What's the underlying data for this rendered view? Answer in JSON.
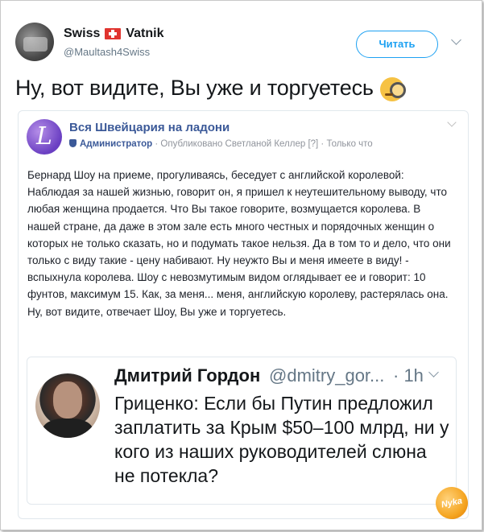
{
  "tweet": {
    "display_name_left": "Swiss",
    "display_name_right": "Vatnik",
    "handle": "@Maultash4Swiss",
    "read_button": "Читать",
    "text": "Ну, вот видите, Вы уже и торгуетесь"
  },
  "fb_post": {
    "page_title": "Вся Швейцария на ладони",
    "role": "Администратор",
    "meta": "· Опубликовано Светланой Келлер [?] · Только что",
    "body": "Бернард Шоу на приеме, прогуливаясь, беседует с английской королевой: Наблюдая за нашей жизнью, говорит он, я пришел к неутешительному выводу, что любая женщина продается. Что Вы такое говорите, возмущается королева. В нашей стране, да даже в этом зале есть много честных и порядочных женщин о которых не только сказать, но и подумать такое нельзя. Да в том то и дело, что они только с виду такие - цену набивают. Ну неужто Вы и меня имеете в виду! - вспыхнула королева. Шоу с невозмутимым видом оглядывает ее и говорит: 10 фунтов, максимум 15. Как, за меня... меня, английскую королеву, растерялась она. Ну, вот видите, отвечает Шоу, Вы уже и торгуетесь."
  },
  "quoted_tweet": {
    "name": "Дмитрий Гордон",
    "handle": "@dmitry_gor...",
    "time": "· 1h",
    "text": "Гриценко: Если бы Путин предложил заплатить за Крым $50–100 млрд, ни у кого из наших руководителей слюна не потекла?"
  },
  "watermark": "Nyka",
  "colors": {
    "twitter_blue": "#1da1f2",
    "facebook_blue": "#3b5998",
    "swiss_red": "#e0342f"
  },
  "icons": [
    "swiss-flag-icon",
    "face-with-monocle-emoji",
    "chevron-down-icon",
    "admin-shield-icon"
  ]
}
